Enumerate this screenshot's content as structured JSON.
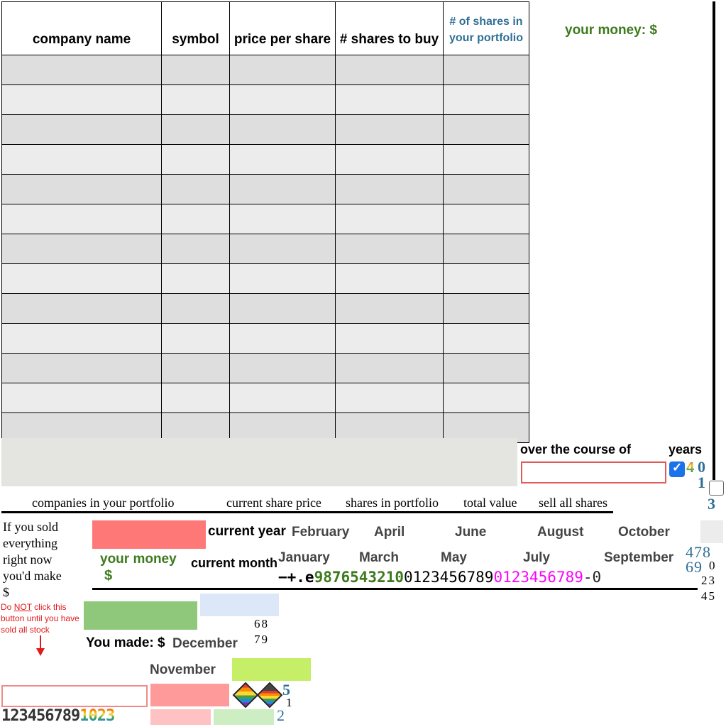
{
  "table": {
    "headers": [
      "company name",
      "symbol",
      "price per share",
      "# shares to buy",
      "# of shares in your portfolio"
    ],
    "row_count": 13
  },
  "wallet": {
    "label": "your money:",
    "currency": "$"
  },
  "course": {
    "over_label": "over the course of",
    "years_label": "years",
    "years_value": ""
  },
  "portfolio_headers": {
    "companies": "companies in your portfolio",
    "current_price": "current share price",
    "shares": "shares in portfolio",
    "total_value": "total value",
    "sell_all": "sell all shares"
  },
  "sold_text": [
    "If you sold",
    "everything",
    "right now",
    "you'd make",
    "$"
  ],
  "warning": {
    "pre": "Do ",
    "not": "NOT",
    "rest": " click this button until you have sold all stock"
  },
  "labels": {
    "current_year": "current year",
    "current_month": "current month",
    "your_money": "your money",
    "money_dollar": "$",
    "you_made": "You made: $"
  },
  "months": [
    "January",
    "February",
    "March",
    "April",
    "May",
    "June",
    "July",
    "August",
    "September",
    "October",
    "November",
    "December"
  ],
  "number_strip": {
    "prefix": "−+.e",
    "green": "9876543210",
    "black": "0123456789",
    "magenta": "0123456789",
    "tail": "-0"
  },
  "bottom_digits": {
    "plain": "123456789",
    "colored": "1023"
  },
  "stray_digits": {
    "a": "4",
    "b": "0",
    "c": "1",
    "d": "3",
    "e": "478",
    "f": "69",
    "g": "0",
    "h": "23",
    "i": "45",
    "j": "68",
    "k": "79",
    "l": "5",
    "m": "1",
    "n": "2"
  },
  "colors": {
    "green_text": "#3e7a1e",
    "blue_text": "#2f6f95",
    "magenta": "#ff00ff",
    "red_button": "#ff7878",
    "green_button": "#8fc87a",
    "lime_button": "#c5ef66",
    "light_blue": "#dce8f8"
  }
}
